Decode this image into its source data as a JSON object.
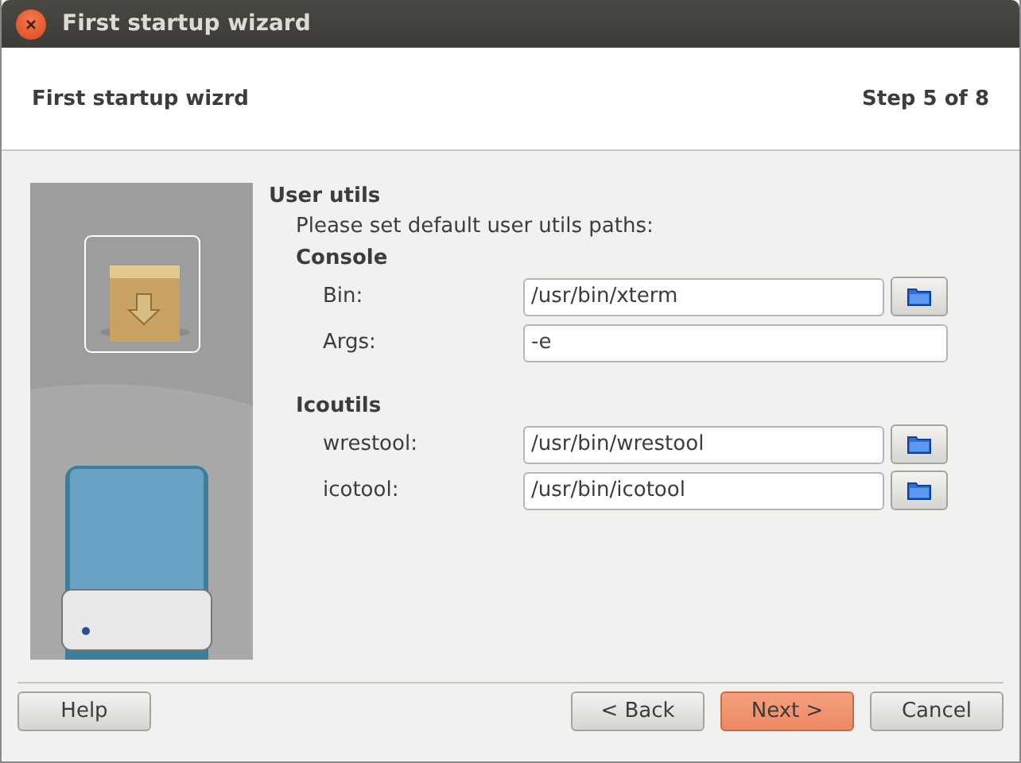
{
  "window": {
    "title": "First startup wizard"
  },
  "header": {
    "title": "First startup wizrd",
    "step": "Step 5 of 8"
  },
  "page": {
    "title": "User utils",
    "description": "Please set default user utils paths:",
    "sections": [
      {
        "title": "Console",
        "rows": [
          {
            "label": "Bin:",
            "value": "/usr/bin/xterm",
            "kind": "path"
          },
          {
            "label": "Args:",
            "value": "-e",
            "kind": "text"
          }
        ]
      },
      {
        "title": "Icoutils",
        "rows": [
          {
            "label": "wrestool:",
            "value": "/usr/bin/wrestool",
            "kind": "path"
          },
          {
            "label": "icotool:",
            "value": "/usr/bin/icotool",
            "kind": "path"
          }
        ]
      }
    ]
  },
  "buttons": [
    {
      "label": "Help",
      "kind": "left",
      "default": false
    },
    {
      "label": "< Back",
      "kind": "right",
      "default": false
    },
    {
      "label": "Next >",
      "kind": "right",
      "default": true
    },
    {
      "label": "Cancel",
      "kind": "right",
      "default": false
    }
  ]
}
